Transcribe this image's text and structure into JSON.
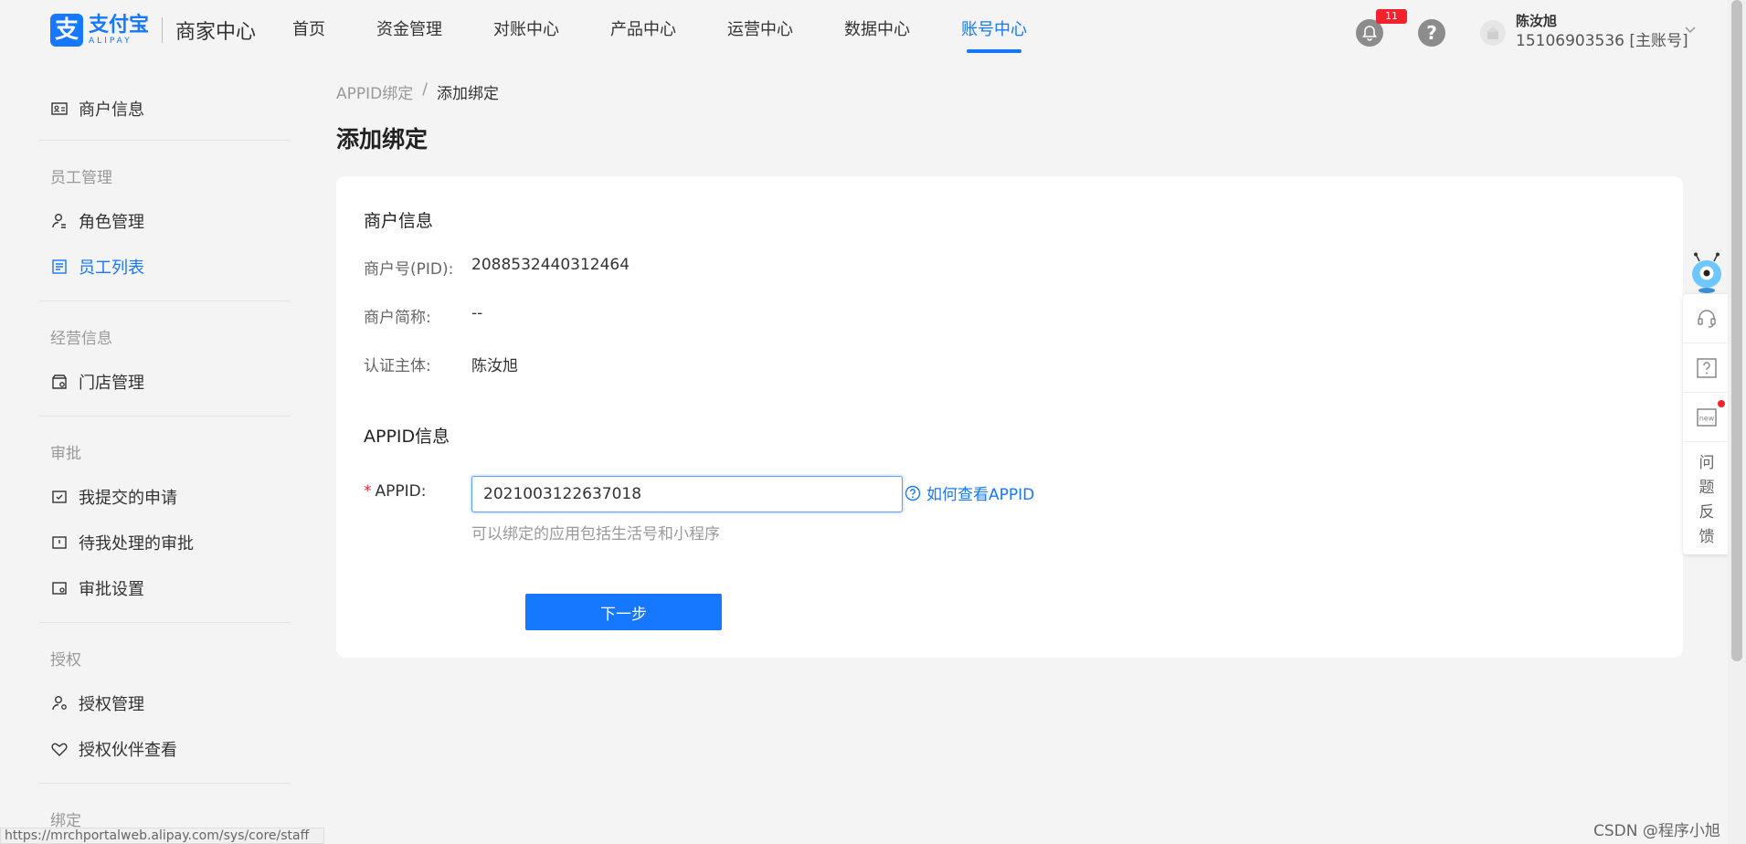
{
  "brand": {
    "logo_cn": "支付宝",
    "logo_en": "ALIPAY",
    "portal": "商家中心",
    "accent": "#1677ff"
  },
  "nav": {
    "items": [
      {
        "label": "首页"
      },
      {
        "label": "资金管理"
      },
      {
        "label": "对账中心"
      },
      {
        "label": "产品中心"
      },
      {
        "label": "运营中心"
      },
      {
        "label": "数据中心"
      },
      {
        "label": "账号中心",
        "active": true
      }
    ]
  },
  "header": {
    "notification_count": "11",
    "help_label": "?",
    "user_name": "陈汝旭",
    "user_account": "15106903536 [主账号]"
  },
  "sidebar": {
    "merchant_info": "商户信息",
    "groups": {
      "staff": "员工管理",
      "business": "经营信息",
      "approval": "审批",
      "auth": "授权",
      "bind": "绑定"
    },
    "items": {
      "role_management": "角色管理",
      "staff_list": "员工列表",
      "store_management": "门店管理",
      "my_applications": "我提交的申请",
      "pending_approvals": "待我处理的审批",
      "approval_settings": "审批设置",
      "auth_management": "授权管理",
      "auth_partner_view": "授权伙伴查看"
    }
  },
  "breadcrumb": {
    "parent": "APPID绑定",
    "separator": "/",
    "current": "添加绑定"
  },
  "page_title": "添加绑定",
  "merchant_section": {
    "title": "商户信息",
    "pid_label": "商户号(PID):",
    "pid_value": "2088532440312464",
    "short_name_label": "商户简称:",
    "short_name_value": "--",
    "subject_label": "认证主体:",
    "subject_value": "陈汝旭"
  },
  "appid_section": {
    "title": "APPID信息",
    "required_mark": "*",
    "appid_label": "APPID:",
    "appid_value": "2021003122637018",
    "howto_link": "如何查看APPID",
    "hint": "可以绑定的应用包括生活号和小程序",
    "next_button": "下一步"
  },
  "float_bar": {
    "feedback_chars": [
      "问",
      "题",
      "反",
      "馈"
    ],
    "new_label": "new"
  },
  "status_url": "https://mrchportalweb.alipay.com/sys/core/staff",
  "watermark": "CSDN @程序小旭"
}
